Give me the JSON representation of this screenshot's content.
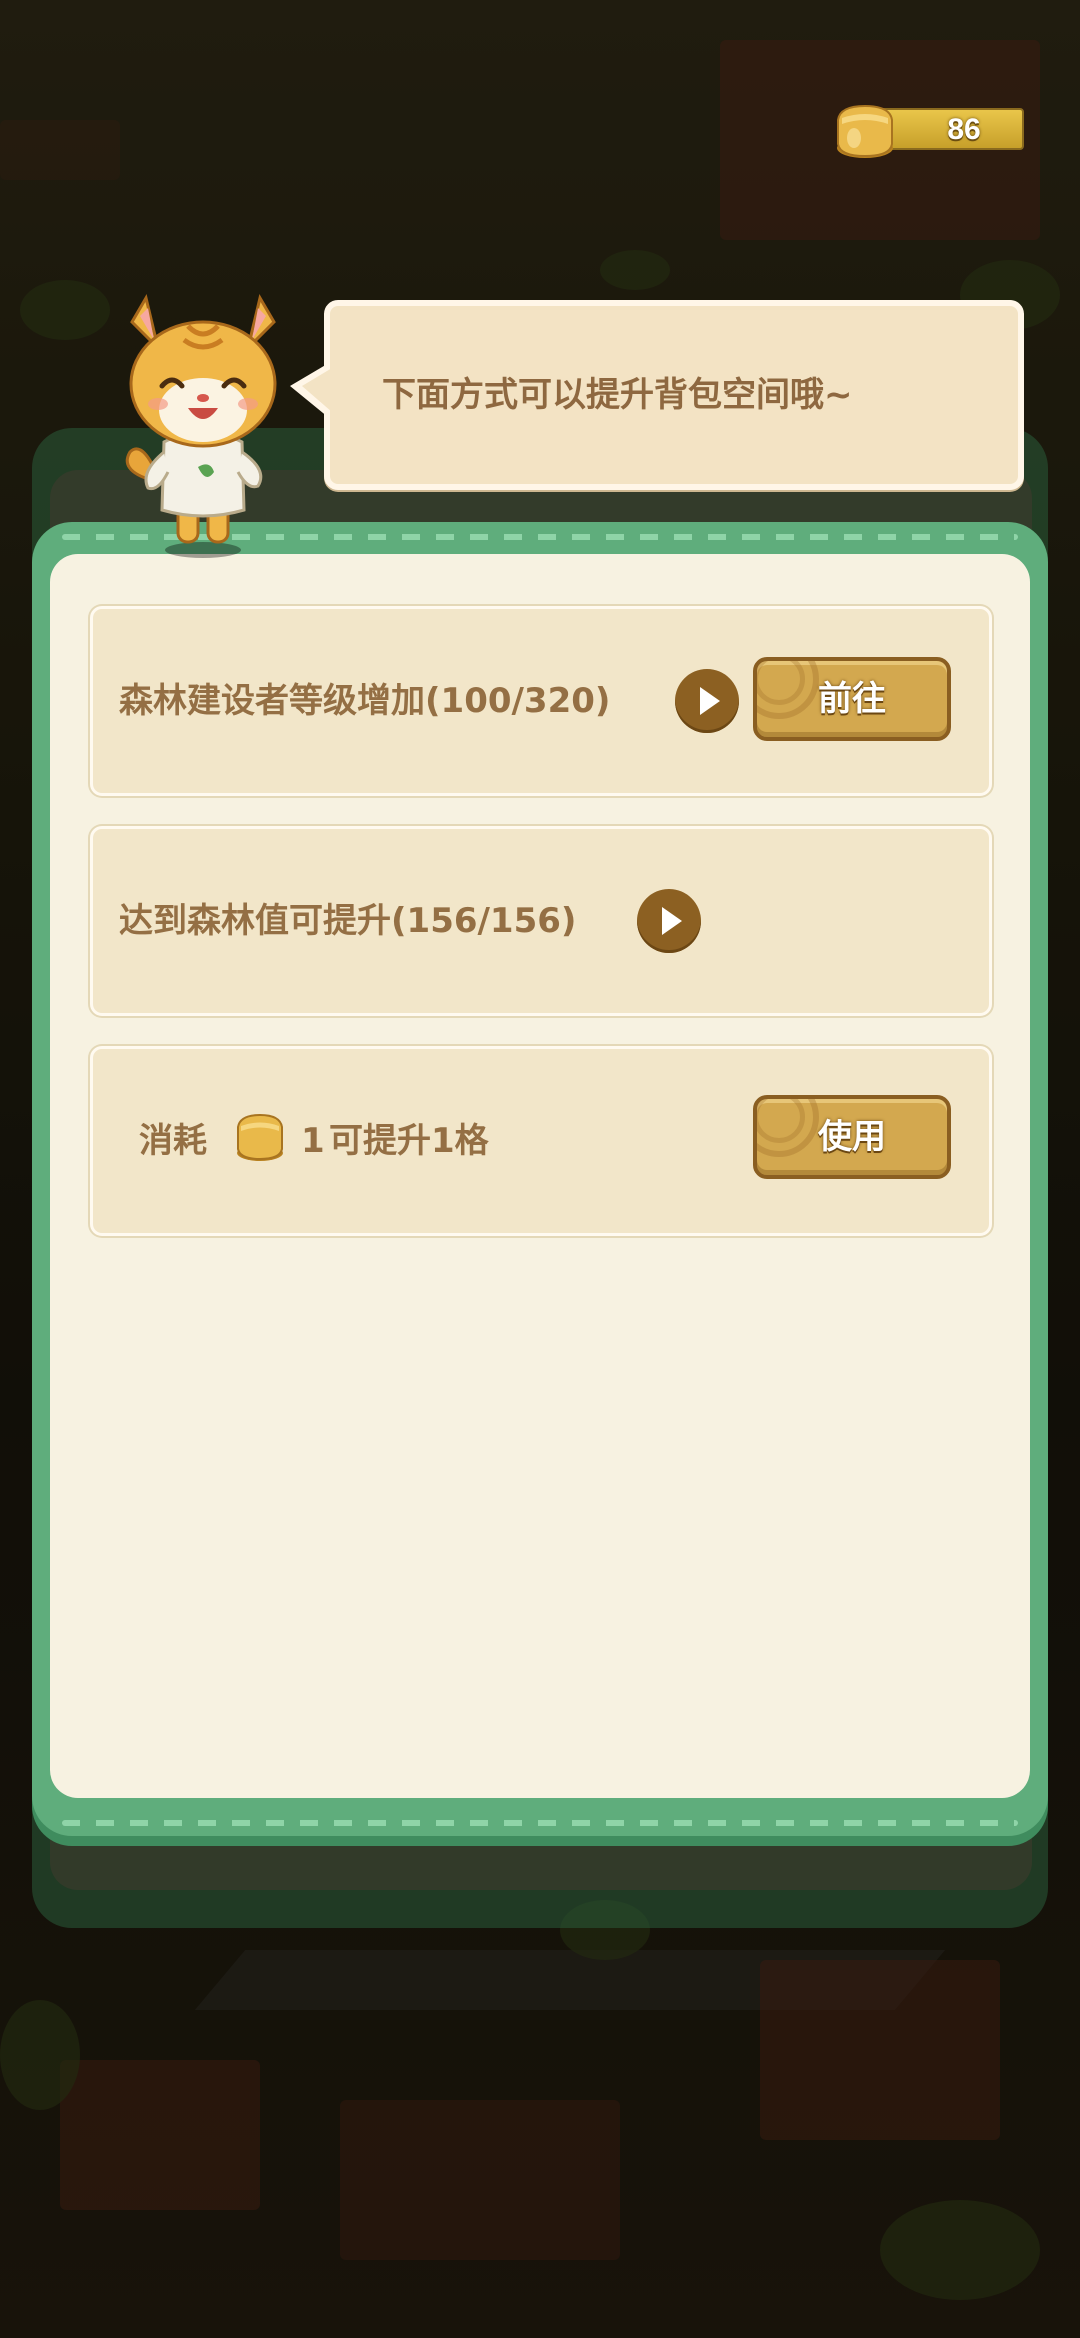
{
  "hud": {
    "coin_count": "86",
    "icon": "gold-bag-icon"
  },
  "dialog": {
    "speech": "下面方式可以提升背包空间哦~",
    "mascot": "orange-cat-mascot"
  },
  "options": [
    {
      "text": "森林建设者等级增加(100/320)",
      "info_icon": "play-arrow-icon",
      "button_label": "前往"
    },
    {
      "text": "达到森林值可提升(156/156)",
      "info_icon": "play-arrow-icon"
    },
    {
      "prefix": "消耗",
      "item_icon": "gold-bag-icon",
      "amount": "1",
      "suffix": "可提升1格",
      "button_label": "使用"
    }
  ],
  "colors": {
    "popup_green": "#5fad7c",
    "panel_cream": "#f7f2e1",
    "row_bg": "#f2e6c9",
    "text_brown": "#946f44",
    "button_gold": "#d3a84f",
    "amount_red": "#e26b3d"
  }
}
